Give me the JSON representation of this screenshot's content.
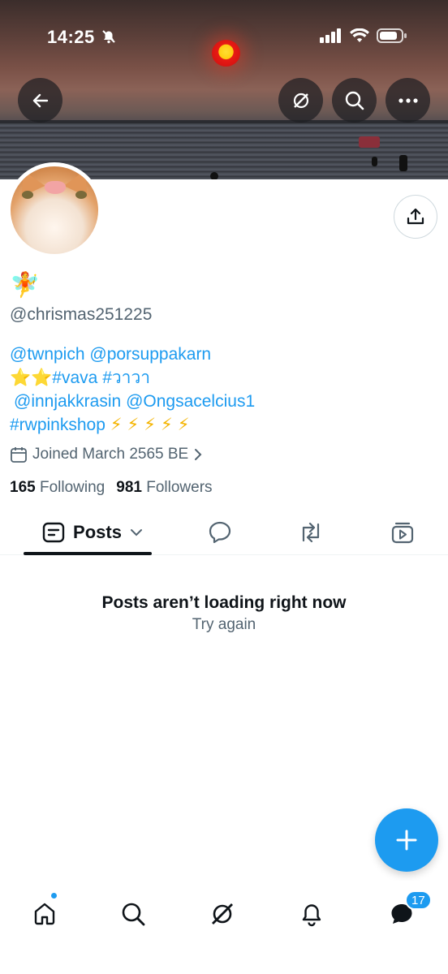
{
  "status_bar": {
    "time": "14:25"
  },
  "profile": {
    "display_name": "🧚",
    "handle": "@chrismas251225",
    "bio": {
      "line1": [
        "@twnpich",
        "@porsuppakarn"
      ],
      "line2_stars": "⭐⭐",
      "line2_tags": [
        "#vava",
        "#วาวา"
      ],
      "line3": [
        "@innjakkrasin",
        "@Ongsacelcius1"
      ],
      "line4_tag": "#rwpinkshop",
      "line4_bolts": "⚡⚡⚡⚡⚡"
    },
    "joined": "Joined March 2565 BE",
    "following_count": "165",
    "following_label": "Following",
    "followers_count": "981",
    "followers_label": "Followers"
  },
  "tabs": {
    "posts_label": "Posts"
  },
  "empty_state": {
    "title": "Posts aren’t loading right now",
    "action": "Try again"
  },
  "nav": {
    "messages_badge": "17"
  },
  "colors": {
    "accent": "#1d9bf0",
    "text": "#0f1419",
    "muted": "#536471"
  }
}
